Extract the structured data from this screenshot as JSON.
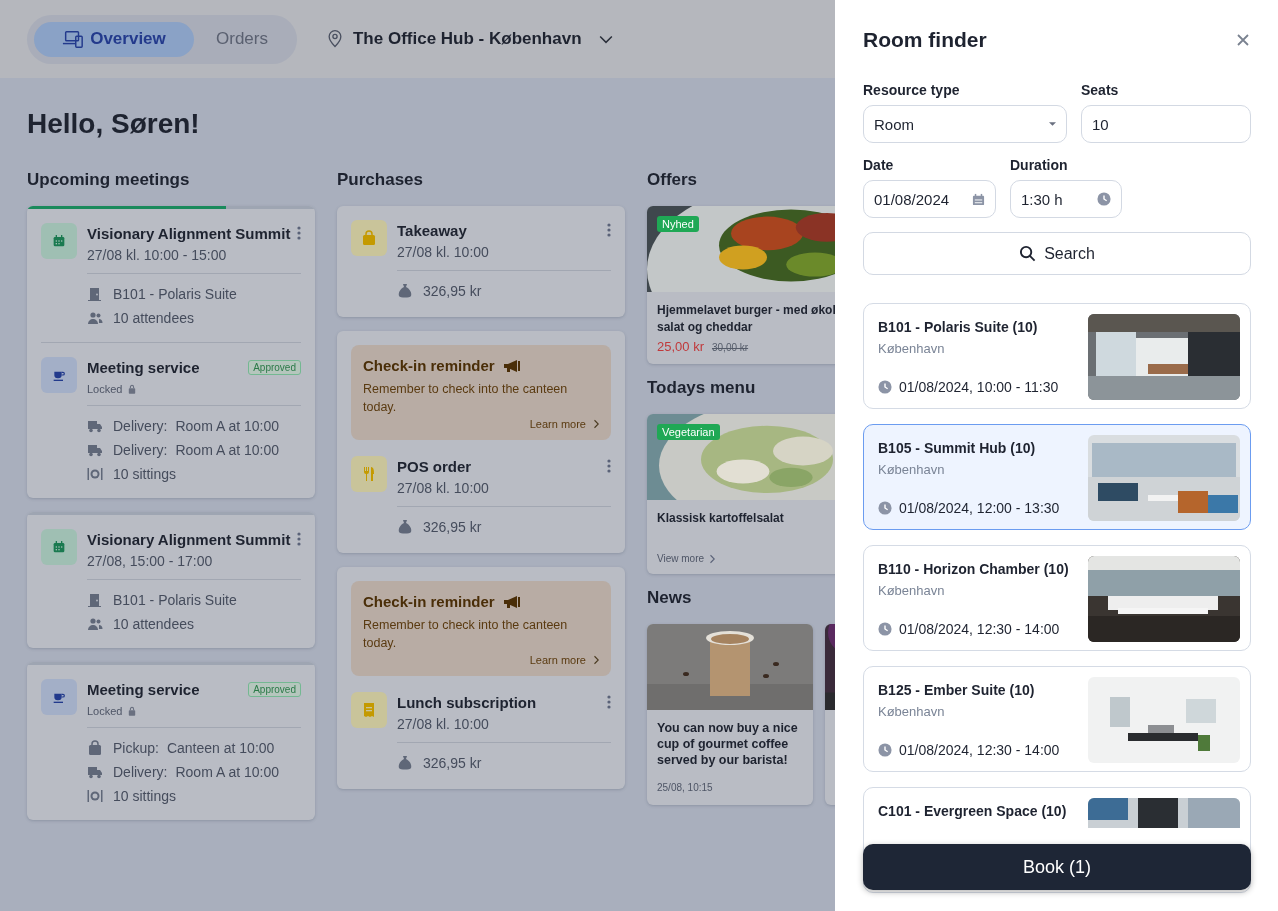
{
  "header": {
    "tabs": [
      {
        "label": "Overview",
        "selected": true
      },
      {
        "label": "Orders",
        "selected": false
      }
    ],
    "location": "The Office Hub - København"
  },
  "greeting": "Hello, Søren!",
  "meetings": {
    "title": "Upcoming meetings",
    "cards": [
      {
        "level": 0.69,
        "entries": [
          {
            "kind": "meeting",
            "title": "Visionary Alignment Summit",
            "time": "27/08 kl. 10:00 - 15:00",
            "details": [
              {
                "kind": "room",
                "value": "B101 - Polaris Suite"
              },
              {
                "kind": "attendees",
                "value": "10 attendees"
              }
            ]
          },
          {
            "kind": "service",
            "title": "Meeting service",
            "badge": "Approved",
            "status": "Locked",
            "details": [
              {
                "kind": "delivery",
                "label": "Delivery:",
                "value": "Room A at 10:00"
              },
              {
                "kind": "delivery",
                "label": "Delivery:",
                "value": "Room A at 10:00"
              },
              {
                "kind": "sittings",
                "value": "10 sittings"
              }
            ]
          }
        ]
      },
      {
        "entries": [
          {
            "kind": "meeting",
            "title": "Visionary Alignment Summit",
            "time": "27/08, 15:00 - 17:00",
            "details": [
              {
                "kind": "room",
                "value": "B101 - Polaris Suite"
              },
              {
                "kind": "attendees",
                "value": "10 attendees"
              }
            ]
          }
        ]
      },
      {
        "entries": [
          {
            "kind": "service",
            "title": "Meeting service",
            "badge": "Approved",
            "status": "Locked",
            "details": [
              {
                "kind": "pickup",
                "label": "Pickup:",
                "value": "Canteen at 10:00"
              },
              {
                "kind": "delivery",
                "label": "Delivery:",
                "value": "Room A at 10:00"
              },
              {
                "kind": "sittings",
                "value": "10 sittings"
              }
            ]
          }
        ]
      }
    ]
  },
  "purchases": {
    "title": "Purchases",
    "cards": [
      {
        "item": {
          "kind": "takeaway",
          "title": "Takeaway",
          "time": "27/08 kl. 10:00",
          "price": "326,95 kr"
        }
      },
      {
        "reminder": {
          "title": "Check-in reminder",
          "text": "Remember to check into the canteen today.",
          "link": "Learn more"
        },
        "item": {
          "kind": "pos",
          "title": "POS order",
          "time": "27/08 kl. 10:00",
          "price": "326,95 kr"
        }
      },
      {
        "reminder": {
          "title": "Check-in reminder",
          "text": "Remember to check into the canteen today.",
          "link": "Learn more"
        },
        "item": {
          "kind": "subscription",
          "title": "Lunch subscription",
          "time": "27/08 kl. 10:00",
          "price": "326,95 kr"
        }
      }
    ]
  },
  "offers": {
    "title": "Offers",
    "tag": "Nyhed",
    "title_lines": [
      "Hjemmelavet burger - med økol",
      "salat og cheddar"
    ],
    "price": "25,00 kr",
    "old_price": "30,00 kr"
  },
  "menu": {
    "title": "Todays menu",
    "tag": "Vegetarian",
    "dish": "Klassisk kartoffelsalat",
    "link": "View more"
  },
  "news": {
    "title": "News",
    "items": [
      {
        "kind": "article",
        "text": "You can now buy a nice cup of gourmet coffee served by our barista!",
        "date": "25/08, 10:15"
      },
      {
        "kind": "picture"
      }
    ]
  },
  "drawer": {
    "title": "Room finder",
    "resource_type": {
      "label": "Resource type",
      "value": "Room"
    },
    "seats": {
      "label": "Seats",
      "value": "10"
    },
    "date": {
      "label": "Date",
      "value": "01/08/2024"
    },
    "duration": {
      "label": "Duration",
      "value": "1:30 h"
    },
    "search": "Search",
    "results": [
      {
        "name": "B101 - Polaris Suite (10)",
        "location": "København",
        "time": "01/08/2024, 10:00 - 11:30",
        "selected": false
      },
      {
        "name": "B105 - Summit Hub (10)",
        "location": "København",
        "time": "01/08/2024, 12:00 - 13:30",
        "selected": true
      },
      {
        "name": "B110 - Horizon Chamber (10)",
        "location": "København",
        "time": "01/08/2024, 12:30 - 14:00",
        "selected": false
      },
      {
        "name": "B125 - Ember Suite (10)",
        "location": "København",
        "time": "01/08/2024, 12:30 - 14:00",
        "selected": false
      },
      {
        "name": "C101 - Evergreen Space (10)",
        "selected": false
      }
    ],
    "book": "Book (1)"
  }
}
